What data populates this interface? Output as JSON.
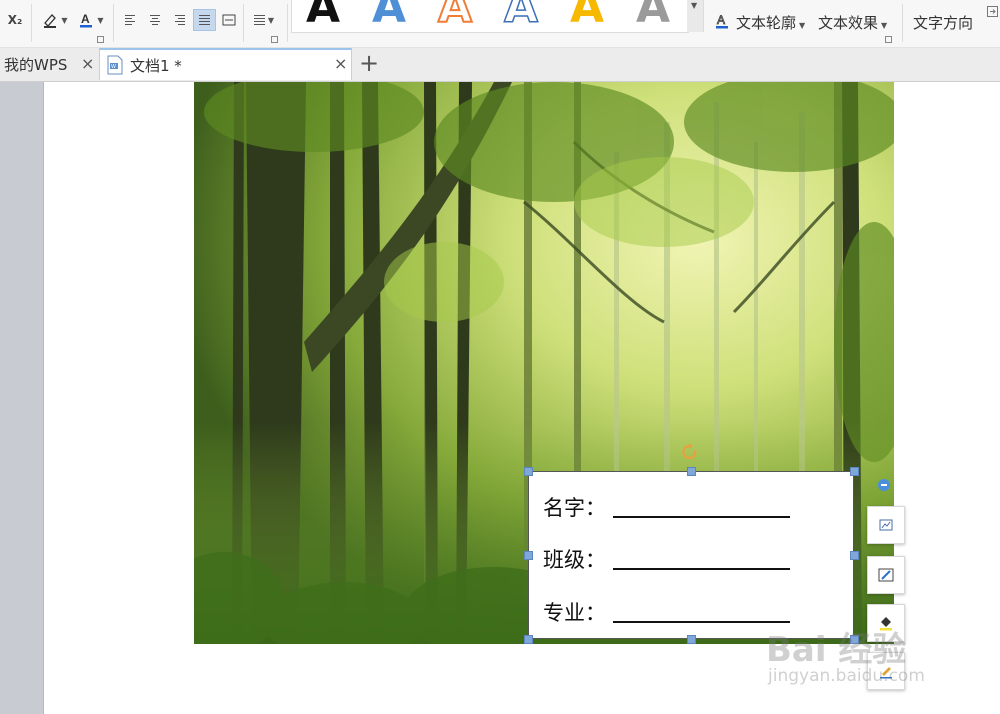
{
  "ribbon": {
    "subscript_label": "X₂",
    "text_outline_label": "文本轮廓",
    "text_effect_label": "文本效果",
    "text_direction_label": "文字方向",
    "wordart_glyph": "A",
    "wordart_styles": [
      {
        "name": "black-fill",
        "color": "#111111"
      },
      {
        "name": "blue-gradient",
        "color": "#4e8fd6"
      },
      {
        "name": "orange-outline",
        "color": "#ef7d36"
      },
      {
        "name": "blue-outline",
        "color": "#3d6fb6"
      },
      {
        "name": "gold-fill",
        "color": "#f7b800"
      },
      {
        "name": "gray-fill",
        "color": "#9a9a9a"
      }
    ]
  },
  "tabs": {
    "home_label": "我的WPS",
    "doc_label": "文档1 *",
    "close_glyph": "×",
    "new_tab_glyph": "+"
  },
  "textbox": {
    "fields": [
      {
        "label": "名字：",
        "blank": ""
      },
      {
        "label": "班级：",
        "blank": ""
      },
      {
        "label": "专业：",
        "blank": ""
      }
    ]
  },
  "side_tools": [
    {
      "name": "layout-options-icon"
    },
    {
      "name": "shape-outline-icon"
    },
    {
      "name": "fill-bucket-icon"
    },
    {
      "name": "pen-color-icon"
    }
  ],
  "watermark": {
    "logo": "Bai 经验",
    "url": "jingyan.baidu.com"
  },
  "colors": {
    "accent": "#4a8fdc",
    "handle": "#7fa7d9",
    "forest_light": "#d9e88a",
    "forest_dark": "#2f4a1a"
  }
}
